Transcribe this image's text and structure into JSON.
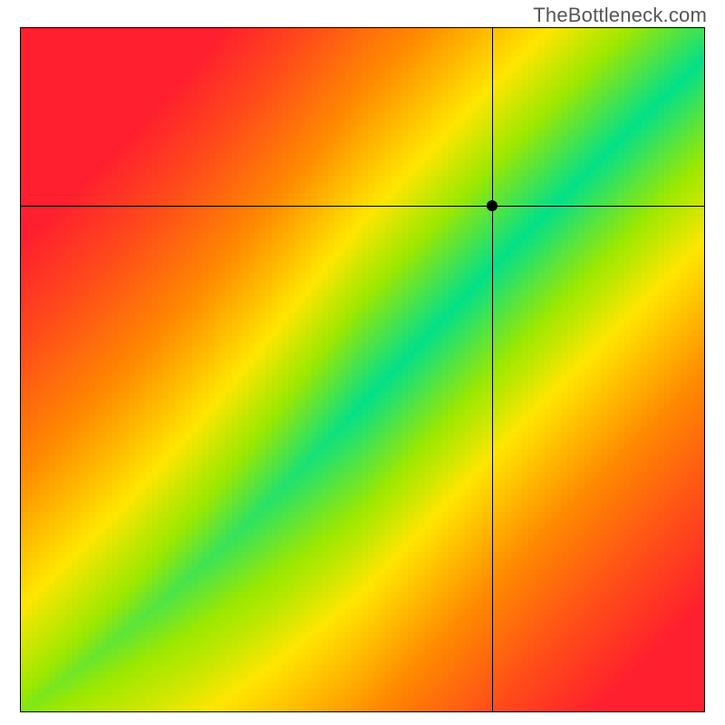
{
  "watermark": "TheBottleneck.com",
  "chart_data": {
    "type": "heatmap",
    "title": "",
    "xlabel": "",
    "ylabel": "",
    "xlim": [
      0,
      1
    ],
    "ylim": [
      0,
      1
    ],
    "marker": {
      "x": 0.69,
      "y": 0.74
    },
    "optimal_band": {
      "center": [
        {
          "x": 0.0,
          "y": 0.0
        },
        {
          "x": 0.1,
          "y": 0.075
        },
        {
          "x": 0.2,
          "y": 0.155
        },
        {
          "x": 0.3,
          "y": 0.245
        },
        {
          "x": 0.4,
          "y": 0.345
        },
        {
          "x": 0.5,
          "y": 0.45
        },
        {
          "x": 0.6,
          "y": 0.555
        },
        {
          "x": 0.7,
          "y": 0.66
        },
        {
          "x": 0.8,
          "y": 0.76
        },
        {
          "x": 0.9,
          "y": 0.86
        },
        {
          "x": 1.0,
          "y": 0.955
        }
      ],
      "half_width_fraction": 0.07
    },
    "color_stops": [
      {
        "t": 0.0,
        "color": "#00e08a"
      },
      {
        "t": 0.15,
        "color": "#9be800"
      },
      {
        "t": 0.3,
        "color": "#ffe600"
      },
      {
        "t": 0.55,
        "color": "#ff8a00"
      },
      {
        "t": 0.8,
        "color": "#ff4a1a"
      },
      {
        "t": 1.0,
        "color": "#ff1f2e"
      }
    ]
  }
}
